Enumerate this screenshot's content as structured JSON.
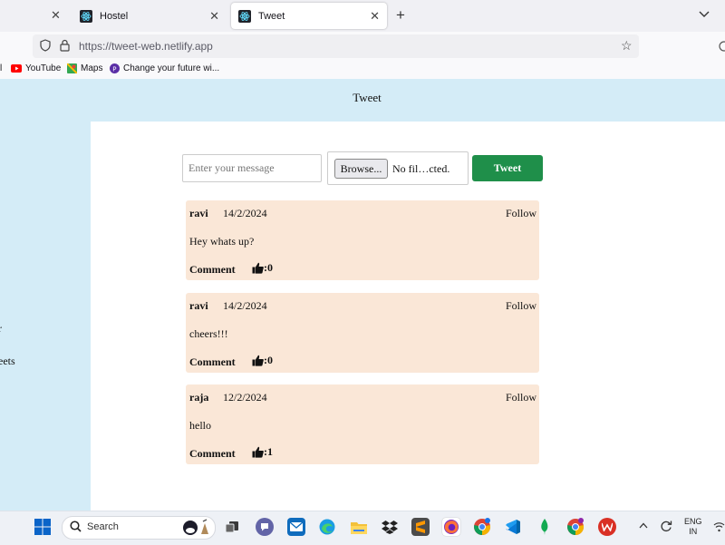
{
  "browser": {
    "tabs": [
      {
        "title": "Hostel"
      },
      {
        "title": "Tweet"
      }
    ],
    "url": "https://tweet-web.netlify.app",
    "bookmarks": [
      {
        "label": "l"
      },
      {
        "label": "YouTube"
      },
      {
        "label": "Maps"
      },
      {
        "label": "Change your future wi..."
      }
    ]
  },
  "page": {
    "title": "Tweet",
    "side_fragments": [
      "r",
      "eets"
    ],
    "composer": {
      "placeholder": "Enter your message",
      "browse_label": "Browse...",
      "file_status": "No fil…cted.",
      "tweet_label": "Tweet"
    },
    "tweets": [
      {
        "user": "ravi",
        "date": "14/2/2024",
        "follow": "Follow",
        "message": "Hey whats up?",
        "comment": "Comment",
        "likes": ":0"
      },
      {
        "user": "ravi",
        "date": "14/2/2024",
        "follow": "Follow",
        "message": "cheers!!!",
        "comment": "Comment",
        "likes": ":0"
      },
      {
        "user": "raja",
        "date": "12/2/2024",
        "follow": "Follow",
        "message": "hello",
        "comment": "Comment",
        "likes": ":1"
      }
    ]
  },
  "taskbar": {
    "search_label": "Search",
    "apps": [
      {
        "name": "task-view"
      },
      {
        "name": "teams"
      },
      {
        "name": "mail"
      },
      {
        "name": "edge"
      },
      {
        "name": "file-explorer"
      },
      {
        "name": "dropbox"
      },
      {
        "name": "sublime"
      },
      {
        "name": "firefox"
      },
      {
        "name": "chrome"
      },
      {
        "name": "vscode"
      },
      {
        "name": "mongodb"
      },
      {
        "name": "chrome-profile"
      },
      {
        "name": "wps"
      }
    ],
    "language": [
      "ENG",
      "IN"
    ]
  },
  "colors": {
    "page_bg": "#d4ecf7",
    "card_bg": "#fae7d7",
    "tweet_button": "#1f8f4a"
  }
}
